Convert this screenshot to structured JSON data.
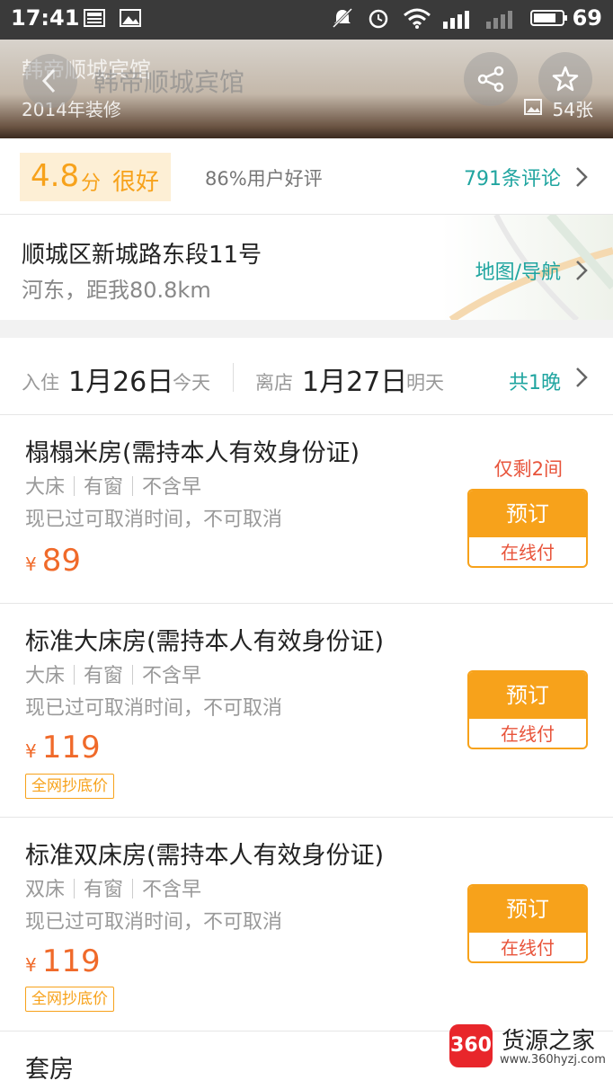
{
  "status_bar": {
    "time": "17:41",
    "battery": "69"
  },
  "hero": {
    "ghost_title": "韩帝顺城宾馆",
    "title": "韩帝顺城宾馆",
    "renovated": "2014年装修",
    "photo_count": "54张"
  },
  "rating": {
    "score": "4.8",
    "score_unit": "分",
    "score_word": "很好",
    "praise": "86%用户好评",
    "reviews": "791条评论"
  },
  "address": {
    "street": "顺城区新城路东段11号",
    "area_distance": "河东，距我80.8km",
    "map_link": "地图/导航"
  },
  "dates": {
    "checkin_label": "入住",
    "checkin_date": "1月26日",
    "checkin_day": "今天",
    "checkout_label": "离店",
    "checkout_date": "1月27日",
    "checkout_day": "明天",
    "nights": "共1晚"
  },
  "rooms": [
    {
      "name": "榻榻米房(需持本人有效身份证)",
      "bed": "大床",
      "window": "有窗",
      "breakfast": "不含早",
      "policy": "现已过可取消时间，不可取消",
      "currency": "¥",
      "price": "89",
      "remaining": "仅剩2间",
      "book": "预订",
      "pay": "在线付"
    },
    {
      "name": "标准大床房(需持本人有效身份证)",
      "bed": "大床",
      "window": "有窗",
      "breakfast": "不含早",
      "policy": "现已过可取消时间，不可取消",
      "currency": "¥",
      "price": "119",
      "badge": "全网抄底价",
      "book": "预订",
      "pay": "在线付"
    },
    {
      "name": "标准双床房(需持本人有效身份证)",
      "bed": "双床",
      "window": "有窗",
      "breakfast": "不含早",
      "policy": "现已过可取消时间，不可取消",
      "currency": "¥",
      "price": "119",
      "badge": "全网抄底价",
      "book": "预订",
      "pay": "在线付"
    },
    {
      "name": "套房"
    }
  ],
  "watermark": {
    "logo": "360",
    "name": "货源之家",
    "url": "www.360hyzj.com"
  },
  "colors": {
    "accent_orange": "#f7a21b",
    "teal_link": "#20a5a0",
    "price_red": "#f06a2a"
  },
  "icons": [
    "back-arrow-icon",
    "share-icon",
    "star-icon",
    "photo-icon",
    "chevron-right-icon",
    "mute-icon",
    "alarm-icon",
    "wifi-icon",
    "signal-icon",
    "battery-icon"
  ]
}
